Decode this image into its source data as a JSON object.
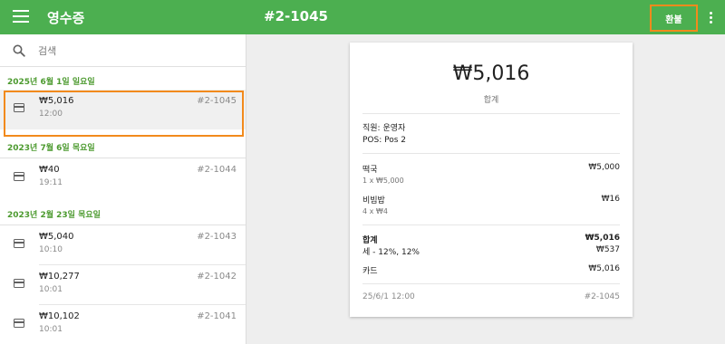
{
  "appbar": {
    "title": "영수증",
    "receipt_number": "#2-1045",
    "refund_label": "환불",
    "bg_color": "#4caf50",
    "highlight_color": "#f28a1c"
  },
  "search": {
    "placeholder": "검색",
    "value": ""
  },
  "list": {
    "groups": [
      {
        "date": "2025년 6월 1일 일요일",
        "items": [
          {
            "amount": "₩5,016",
            "time": "12:00",
            "number": "#2-1045",
            "selected": true
          }
        ]
      },
      {
        "date": "2023년 7월 6일 목요일",
        "items": [
          {
            "amount": "₩40",
            "time": "19:11",
            "number": "#2-1044"
          }
        ]
      },
      {
        "date": "2023년 2월 23일 목요일",
        "items": [
          {
            "amount": "₩5,040",
            "time": "10:10",
            "number": "#2-1043"
          },
          {
            "amount": "₩10,277",
            "time": "10:01",
            "number": "#2-1042"
          },
          {
            "amount": "₩10,102",
            "time": "10:01",
            "number": "#2-1041"
          }
        ]
      }
    ]
  },
  "receipt": {
    "total": "₩5,016",
    "total_label": "합계",
    "staff": "직원: 운영자",
    "pos": "POS: Pos 2",
    "lines": [
      {
        "name": "떡국",
        "qty": "1 x ₩5,000",
        "price": "₩5,000"
      },
      {
        "name": "비빔밥",
        "qty": "4 x ₩4",
        "price": "₩16"
      }
    ],
    "sum_label": "합계",
    "sum_value": "₩5,016",
    "tax_label": "세 - 12%, 12%",
    "tax_value": "₩537",
    "payment_label": "카드",
    "payment_value": "₩5,016",
    "datetime": "25/6/1 12:00",
    "number": "#2-1045"
  }
}
